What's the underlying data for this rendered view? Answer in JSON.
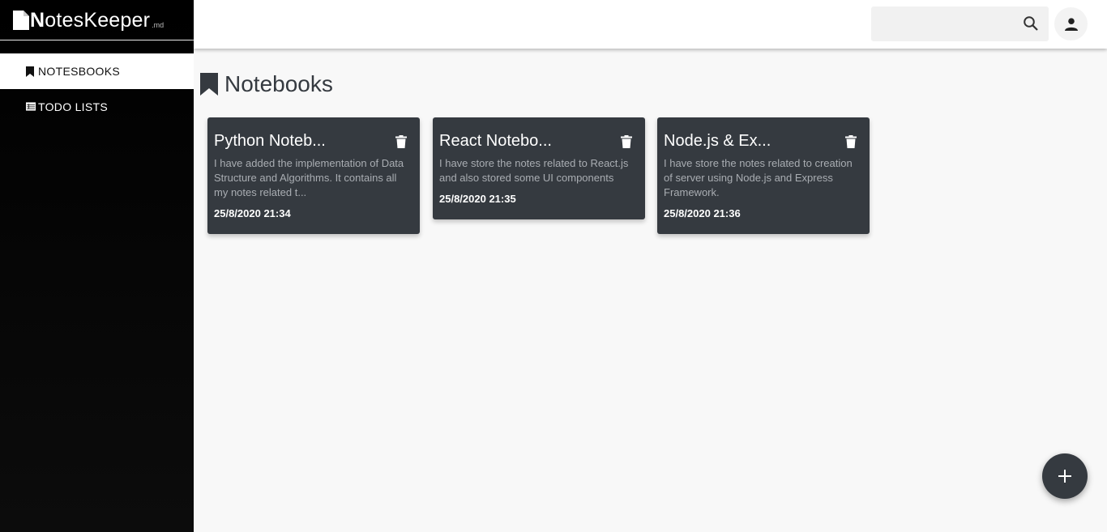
{
  "app": {
    "logo_prefix": "N",
    "logo_rest": "otesKeeper",
    "logo_suffix": ".md"
  },
  "sidebar": {
    "items": [
      {
        "label": "NOTESBOOKS",
        "icon": "bookmark-icon",
        "active": true
      },
      {
        "label": "TODO LISTS",
        "icon": "list-icon",
        "active": false
      }
    ]
  },
  "header": {
    "search": {
      "value": "",
      "placeholder": ""
    }
  },
  "main": {
    "title": "Notebooks",
    "cards": [
      {
        "title": "Python Noteb...",
        "description": "I have added the implementation of Data Structure and Algorithms. It contains all my notes related t...",
        "date": "25/8/2020 21:34"
      },
      {
        "title": "React Notebo...",
        "description": "I have store the notes related to React.js and also stored some UI components",
        "date": "25/8/2020 21:35"
      },
      {
        "title": "Node.js & Ex...",
        "description": "I have store the notes related to creation of server using Node.js and Express Framework.",
        "date": "25/8/2020 21:36"
      }
    ]
  },
  "colors": {
    "card_bg": "#353a40",
    "sidebar_bg": "#000000",
    "page_bg": "#f8f8f8"
  }
}
